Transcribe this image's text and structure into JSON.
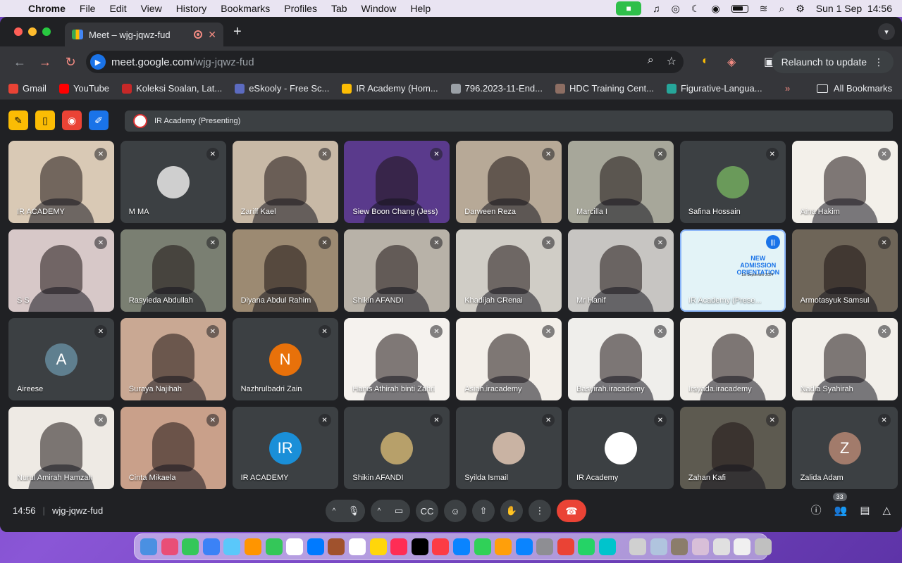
{
  "menubar": {
    "app": "Chrome",
    "items": [
      "File",
      "Edit",
      "View",
      "History",
      "Bookmarks",
      "Profiles",
      "Tab",
      "Window",
      "Help"
    ],
    "datetime": "Sun 1 Sep  14:56"
  },
  "tab": {
    "title": "Meet – wjg-jqwz-fud",
    "close_glyph": "✕"
  },
  "toolbar": {
    "url_host": "meet.google.com",
    "url_path": "/wjg-jqwz-fud",
    "relaunch_label": "Relaunch to update"
  },
  "bookmarks": {
    "items": [
      {
        "label": "Gmail",
        "color": "#ea4335"
      },
      {
        "label": "YouTube",
        "color": "#ff0000"
      },
      {
        "label": "Koleksi Soalan, Lat...",
        "color": "#c62828"
      },
      {
        "label": "eSkooly - Free Sc...",
        "color": "#5c6bc0"
      },
      {
        "label": "IR Academy (Hom...",
        "color": "#fbbc04"
      },
      {
        "label": "796.2023-11-End...",
        "color": "#9aa0a6"
      },
      {
        "label": "HDC Training Cent...",
        "color": "#8d6e63"
      },
      {
        "label": "Figurative-Langua...",
        "color": "#26a69a"
      }
    ],
    "more": "»",
    "all_label": "All Bookmarks"
  },
  "meet": {
    "presenting_label": "IR Academy (Presenting)",
    "meeting_code": "wjg-jqwz-fud",
    "time": "14:56",
    "participant_count": "33",
    "tiles": [
      {
        "name": "IR ACADEMY",
        "kind": "video",
        "bg": "#d9c9b5"
      },
      {
        "name": "M MA",
        "kind": "photo",
        "bg": "#3c4043",
        "avatar_color": "#cfcfcf"
      },
      {
        "name": "Zariff Kael",
        "kind": "video",
        "bg": "#c8b9a6"
      },
      {
        "name": "Siew Boon Chang (Jess)",
        "kind": "video",
        "bg": "#5a3a8c"
      },
      {
        "name": "Darween Reza",
        "kind": "video",
        "bg": "#b7a997"
      },
      {
        "name": "Marcilla I",
        "kind": "video",
        "bg": "#a7a79a"
      },
      {
        "name": "Safina Hossain",
        "kind": "photo",
        "bg": "#3c4043",
        "avatar_color": "#6a9a5a"
      },
      {
        "name": "Aina Hakim",
        "kind": "video",
        "bg": "#f3f0ea"
      },
      {
        "name": "S S",
        "kind": "video",
        "bg": "#d7c8c8"
      },
      {
        "name": "Rasyieda Abdullah",
        "kind": "video",
        "bg": "#7a7f72"
      },
      {
        "name": "Diyana Abdul Rahim",
        "kind": "video",
        "bg": "#9c8a72"
      },
      {
        "name": "Shikin AFANDI",
        "kind": "video",
        "bg": "#b8b2a8"
      },
      {
        "name": "Khadijah CRenai",
        "kind": "video",
        "bg": "#d0cdc6"
      },
      {
        "name": "Mr Hanif",
        "kind": "video",
        "bg": "#c7c5c2"
      },
      {
        "name": "IR Academy (Prese...",
        "kind": "slide",
        "bg": "#e3f3f7",
        "slide_title": "NEW ADMISSION ORIENTATION",
        "slide_date": "1st September 2024"
      },
      {
        "name": "Armotasyuk Samsul",
        "kind": "video",
        "bg": "#6e6558"
      },
      {
        "name": "Aireese",
        "kind": "letter",
        "bg": "#3c4043",
        "letter": "A",
        "avatar_color": "#5f7f8f"
      },
      {
        "name": "Suraya Najihah",
        "kind": "video",
        "bg": "#c9a893"
      },
      {
        "name": "Nazhrulbadri Zain",
        "kind": "letter",
        "bg": "#3c4043",
        "letter": "N",
        "avatar_color": "#e8710a"
      },
      {
        "name": "Hanis Athirah binti Zahri",
        "kind": "video",
        "bg": "#f5f2ee"
      },
      {
        "name": "Asiah.iracademy",
        "kind": "video",
        "bg": "#f3efe9"
      },
      {
        "name": "Basyirah.iracademy",
        "kind": "video",
        "bg": "#efeeeb"
      },
      {
        "name": "Irsyada.iracademy",
        "kind": "video",
        "bg": "#f1eee9"
      },
      {
        "name": "Nadia Syahirah",
        "kind": "video",
        "bg": "#f2efea"
      },
      {
        "name": "Nurul Amirah Hamzah",
        "kind": "video",
        "bg": "#eeeae4"
      },
      {
        "name": "Cinta Mikaela",
        "kind": "video",
        "bg": "#c9a08a"
      },
      {
        "name": "IR ACADEMY",
        "kind": "letter",
        "bg": "#3c4043",
        "letter": "IR",
        "avatar_color": "#1a8fd8"
      },
      {
        "name": "Shikin AFANDI",
        "kind": "photo",
        "bg": "#3c4043",
        "avatar_color": "#b7a06a"
      },
      {
        "name": "Syilda Ismail",
        "kind": "photo",
        "bg": "#3c4043",
        "avatar_color": "#c9b3a3"
      },
      {
        "name": "IR Academy",
        "kind": "photo",
        "bg": "#3c4043",
        "avatar_color": "#ffffff"
      },
      {
        "name": "Zahan Kafi",
        "kind": "video",
        "bg": "#5d5a50"
      },
      {
        "name": "Zalida Adam",
        "kind": "letter",
        "bg": "#3c4043",
        "letter": "Z",
        "avatar_color": "#a27b6b"
      }
    ]
  },
  "colors": {
    "accent": "#1a73e8",
    "hangup": "#ea4335",
    "tile_bg": "#3c4043",
    "meet_bg": "#202124"
  },
  "dock_colors": [
    "#4a90e2",
    "#e94e77",
    "#34c759",
    "#3b82f6",
    "#5ac8fa",
    "#ff9500",
    "#34c759",
    "#ffffff",
    "#007aff",
    "#a0522d",
    "#ffffff",
    "#ffd60a",
    "#ff2d55",
    "#000000",
    "#fc3c44",
    "#0a84ff",
    "#30d158",
    "#ff9f0a",
    "#0a84ff",
    "#8e8e93",
    "#ea4335",
    "#25d366",
    "#00c4cc",
    "#d0d0d0",
    "#b0c4de",
    "#8b7d6b",
    "#d8bfd8",
    "#e0e0e0",
    "#f0f0f0",
    "#c0c0c0"
  ]
}
